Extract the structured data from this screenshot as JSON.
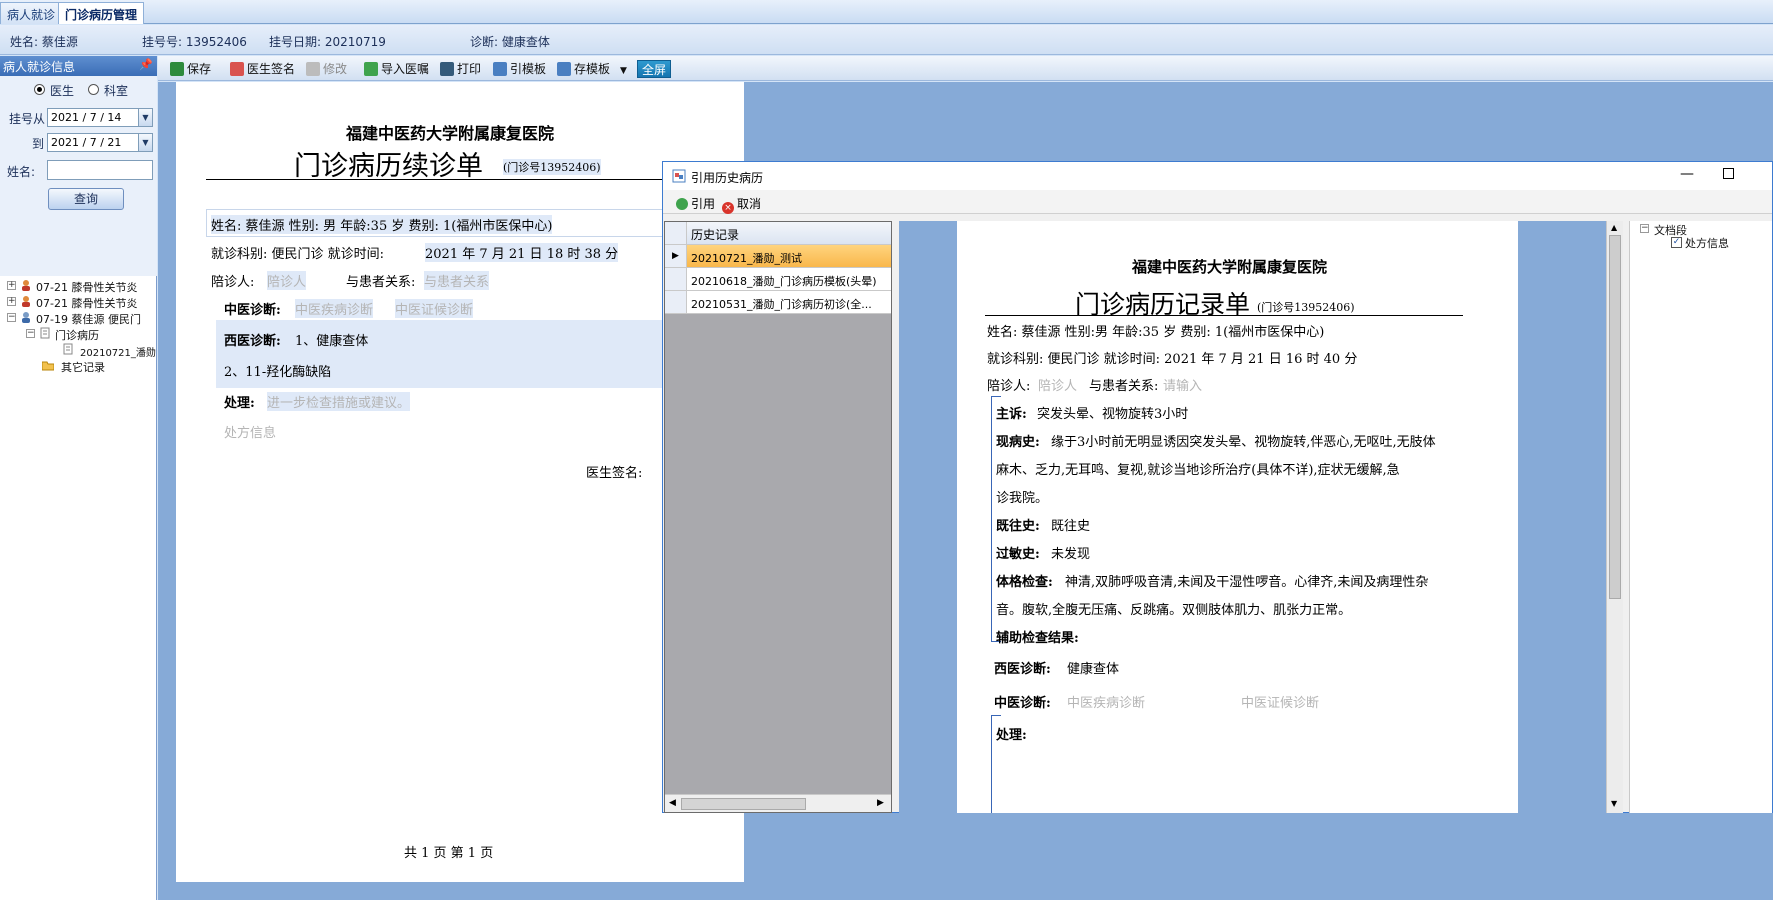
{
  "tabs": [
    "病人就诊",
    "门诊病历管理"
  ],
  "infobar": {
    "name": "姓名: 蔡佳源",
    "reg_no": "挂号号: 13952406",
    "reg_date": "挂号日期: 20210719",
    "diagnosis": "诊断: 健康查体"
  },
  "left_panel": {
    "title": "病人就诊信息",
    "radio_doctor": "医生",
    "radio_dept": "科室",
    "date_from_label": "挂号从",
    "date_from": "2021 / 7 / 14",
    "date_to_label": "到",
    "date_to": "2021 / 7 / 21",
    "name_label": "姓名:",
    "name_value": "",
    "query_button": "查询",
    "tree": [
      "07-21  膝骨性关节炎",
      "07-21  膝骨性关节炎",
      "07-19  蔡佳源  便民门",
      "门诊病历",
      "20210721_潘勋",
      "其它记录"
    ]
  },
  "toolbar": {
    "save": "保存",
    "doctor_sign": "医生签名",
    "modify": "修改",
    "import_order": "导入医嘱",
    "print": "打印",
    "cite_template": "引模板",
    "save_template": "存模板",
    "fullscreen": "全屏"
  },
  "document": {
    "hospital": "福建中医药大学附属康复医院",
    "title": "门诊病历续诊单",
    "clinic_no": "(门诊号13952406)",
    "row1": "姓名: 蔡佳源     性别: 男     年龄:35 岁     费别: 1(福州市医保中心)",
    "row2_label": "就诊科别: 便民门诊     就诊时间: ",
    "row2_time": "2021 年 7 月 21 日 18 时 38 分",
    "accompany_label": "陪诊人: ",
    "accompany_ph": "陪诊人",
    "relation_label": "与患者关系: ",
    "relation_ph": "与患者关系",
    "tcm_label": "中医诊断: ",
    "tcm_ph1": "中医疾病诊断",
    "tcm_ph2": "中医证候诊断",
    "wm_label": "西医诊断: ",
    "wm_value": "1、健康查体",
    "wm_value2": "2、11-羟化酶缺陷",
    "treat_label": "处理: ",
    "treat_ph": "进一步检查措施或建议。",
    "rx_ph": "处方信息",
    "sign_label": "医生签名:",
    "page_footer": "共 1 页    第  1 页"
  },
  "dialog": {
    "title": "引用历史病历",
    "cite_button": "引用",
    "cancel_button": "取消",
    "history_header": "历史记录",
    "history": [
      "20210721_潘勋_测试",
      "20210618_潘勋_门诊病历模板(头晕)",
      "20210531_潘勋_门诊病历初诊(全..."
    ],
    "preview": {
      "hospital": "福建中医药大学附属康复医院",
      "title": "门诊病历记录单",
      "clinic_no": "(门诊号13952406)",
      "row1": "姓名: 蔡佳源     性别:男     年龄:35 岁     费别: 1(福州市医保中心)",
      "row2": "就诊科别: 便民门诊  就诊时间: 2021 年 7 月 21 日 16 时 40 分",
      "accompany_label": "陪诊人: ",
      "accompany_ph": "陪诊人",
      "relation_label": "与患者关系: ",
      "relation_ph": "请输入",
      "complaint_label": "主诉: ",
      "complaint": "突发头晕、视物旋转3小时",
      "hpi_label": "现病史: ",
      "hpi_1": "缘于3小时前无明显诱因突发头晕、视物旋转,伴恶心,无呕吐,无肢体",
      "hpi_2": "麻木、乏力,无耳鸣、复视,就诊当地诊所治疗(具体不详),症状无缓解,急",
      "hpi_3": "诊我院。",
      "past_label": "既往史: ",
      "past": "既往史",
      "allergy_label": "过敏史: ",
      "allergy": "未发现",
      "exam_label": "体格检查: ",
      "exam_1": "神清,双肺呼吸音清,未闻及干湿性啰音。心律齐,未闻及病理性杂",
      "exam_2": "音。腹软,全腹无压痛、反跳痛。双侧肢体肌力、肌张力正常。",
      "aux_label": "辅助检查结果:",
      "wm_label": "西医诊断: ",
      "wm_value": "健康查体",
      "tcm_label": "中医诊断: ",
      "tcm_ph1": "中医疾病诊断",
      "tcm_ph2": "中医证候诊断",
      "treat_label": "处理:"
    },
    "right_tree": {
      "root": "文档段",
      "child": "处方信息"
    }
  }
}
